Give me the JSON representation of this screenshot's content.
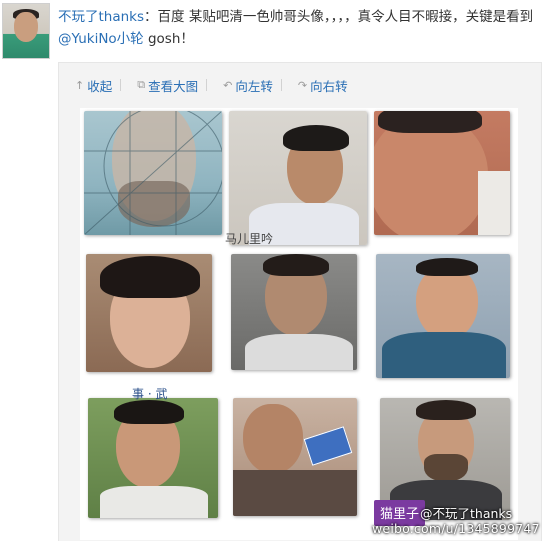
{
  "post": {
    "username": "不玩了thanks",
    "colon": "：",
    "text_before_mention": "百度 某贴吧清一色帅哥头像，，，，真令人目不暇接，关键是看到",
    "mention": "@YukiNo小轮",
    "text_after_mention": " gosh！"
  },
  "toolbar": {
    "collapse_label": "收起",
    "view_large_label": "查看大图",
    "rotate_left_label": "向左转",
    "rotate_right_label": "向右转"
  },
  "stray_text": {
    "caption_1": "马儿里吟",
    "caption_2": "事 · 武"
  },
  "watermark": {
    "tag": "猫里子",
    "handle": "@不玩了thanks",
    "url": "weibo.com/u/1345899747"
  },
  "colors": {
    "link": "#2a6fb5",
    "tag_bg": "#7b3aa0"
  }
}
